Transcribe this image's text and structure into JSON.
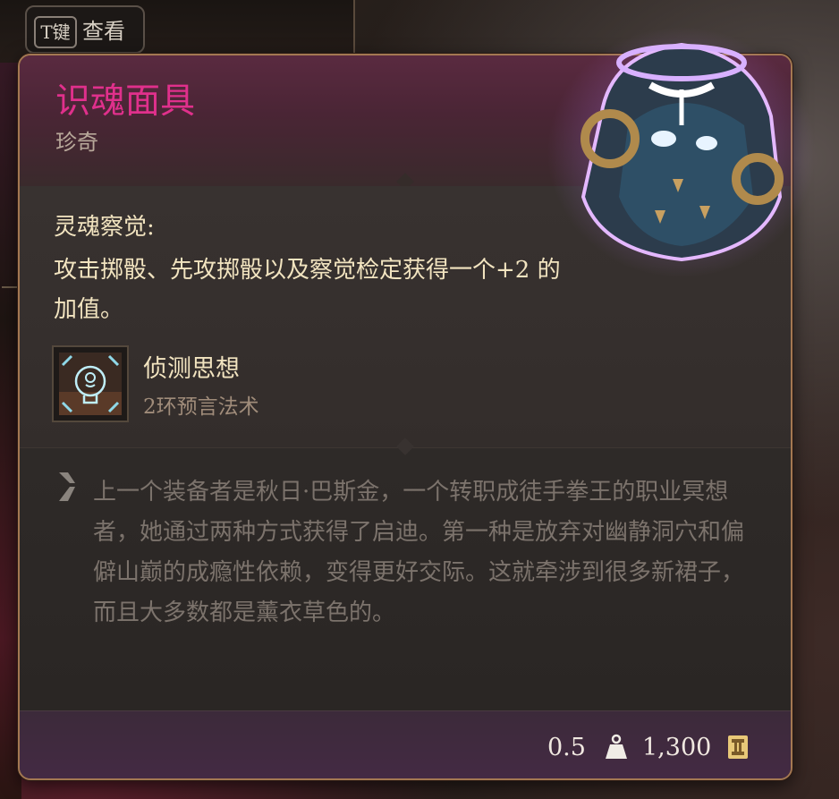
{
  "key_hint": {
    "key": "T键",
    "label": "查看"
  },
  "item": {
    "name": "识魂面具",
    "rarity": "珍奇",
    "rarity_color": "#e0308c"
  },
  "passive": {
    "title": "灵魂察觉:",
    "description": "攻击掷骰、先攻掷骰以及察觉检定获得一个+2 的加值。"
  },
  "spell": {
    "name": "侦测思想",
    "level": "2环预言法术",
    "icon": "detect-thoughts-icon"
  },
  "lore": {
    "text": "上一个装备者是秋日·巴斯金，一个转职成徒手拳王的职业冥想者，她通过两种方式获得了启迪。第一种是放弃对幽静洞穴和偏僻山巅的成瘾性依赖，变得更好交际。这就牵涉到很多新裙子，而且大多数都是薰衣草色的。"
  },
  "footer": {
    "weight": "0.5",
    "weight_icon": "weight-icon",
    "price": "1,300",
    "price_icon": "gold-coin-icon"
  },
  "colors": {
    "border": "#a47852",
    "text_primary": "#f2e4c0",
    "text_lore": "#7c736c",
    "header_bg": "#5a2a40",
    "footer_bg": "#442a44"
  }
}
